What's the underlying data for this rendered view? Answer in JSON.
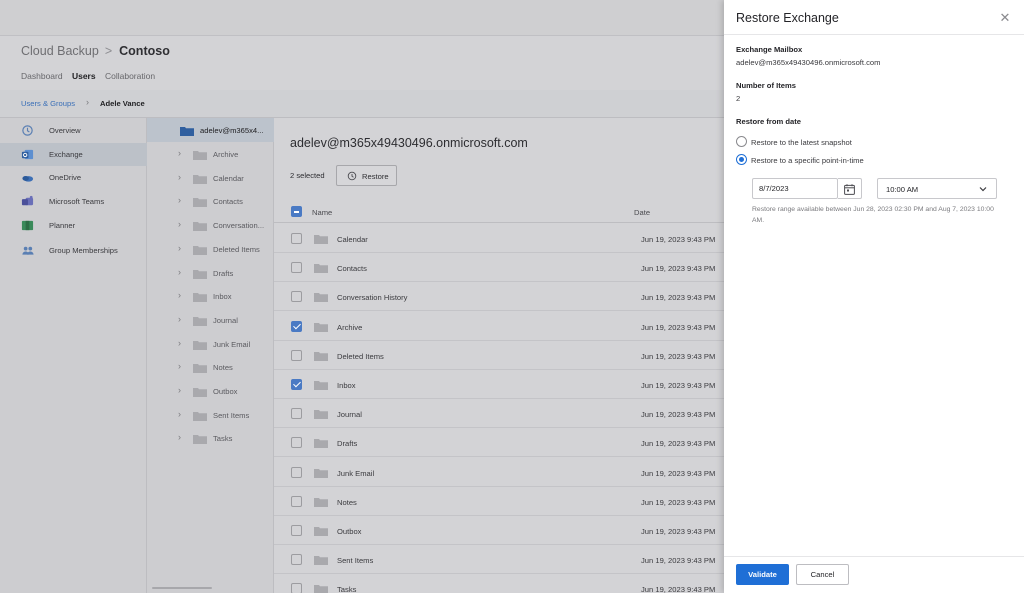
{
  "app": {
    "product": "Cloud Backup",
    "org": "Contoso",
    "tabs": [
      "Dashboard",
      "Users",
      "Collaboration"
    ],
    "active_tab": "Users",
    "breadcrumb": {
      "parent": "Users & Groups",
      "current": "Adele Vance"
    }
  },
  "sidebar": {
    "items": [
      {
        "label": "Overview",
        "icon": "history-icon"
      },
      {
        "label": "Exchange",
        "icon": "outlook-icon",
        "selected": true
      },
      {
        "label": "OneDrive",
        "icon": "onedrive-icon"
      },
      {
        "label": "Microsoft Teams",
        "icon": "teams-icon"
      },
      {
        "label": "Planner",
        "icon": "planner-icon"
      },
      {
        "label": "Group Memberships",
        "icon": "people-icon"
      }
    ]
  },
  "folder_tree": {
    "root": "adelev@m365x4...",
    "folders": [
      "Archive",
      "Calendar",
      "Contacts",
      "Conversation...",
      "Deleted Items",
      "Drafts",
      "Inbox",
      "Journal",
      "Junk Email",
      "Notes",
      "Outbox",
      "Sent Items",
      "Tasks"
    ]
  },
  "main": {
    "title": "adelev@m365x49430496.onmicrosoft.com",
    "selected_count": "2 selected",
    "restore_label": "Restore",
    "columns": {
      "name": "Name",
      "date": "Date"
    },
    "rows": [
      {
        "name": "Calendar",
        "date": "Jun 19, 2023 9:43 PM",
        "checked": false
      },
      {
        "name": "Contacts",
        "date": "Jun 19, 2023 9:43 PM",
        "checked": false
      },
      {
        "name": "Conversation History",
        "date": "Jun 19, 2023 9:43 PM",
        "checked": false
      },
      {
        "name": "Archive",
        "date": "Jun 19, 2023 9:43 PM",
        "checked": true
      },
      {
        "name": "Deleted Items",
        "date": "Jun 19, 2023 9:43 PM",
        "checked": false
      },
      {
        "name": "Inbox",
        "date": "Jun 19, 2023 9:43 PM",
        "checked": true
      },
      {
        "name": "Journal",
        "date": "Jun 19, 2023 9:43 PM",
        "checked": false
      },
      {
        "name": "Drafts",
        "date": "Jun 19, 2023 9:43 PM",
        "checked": false
      },
      {
        "name": "Junk Email",
        "date": "Jun 19, 2023 9:43 PM",
        "checked": false
      },
      {
        "name": "Notes",
        "date": "Jun 19, 2023 9:43 PM",
        "checked": false
      },
      {
        "name": "Outbox",
        "date": "Jun 19, 2023 9:43 PM",
        "checked": false
      },
      {
        "name": "Sent Items",
        "date": "Jun 19, 2023 9:43 PM",
        "checked": false
      },
      {
        "name": "Tasks",
        "date": "Jun 19, 2023 9:43 PM",
        "checked": false
      }
    ]
  },
  "panel": {
    "title": "Restore Exchange",
    "mailbox_label": "Exchange Mailbox",
    "mailbox_value": "adelev@m365x49430496.onmicrosoft.com",
    "items_label": "Number of Items",
    "items_value": "2",
    "restore_from_label": "Restore from date",
    "option_latest": "Restore to the latest snapshot",
    "option_point": "Restore to a specific point-in-time",
    "selected_option": "point",
    "date_value": "8/7/2023",
    "time_value": "10:00 AM",
    "hint": "Restore range available between Jun 28, 2023 02:30 PM and Aug 7, 2023 10:00 AM.",
    "validate_label": "Validate",
    "cancel_label": "Cancel"
  },
  "colors": {
    "accent": "#1f6fd6",
    "checkbox_dimmed": "#4a7ac4",
    "folder": "#a9a9ad",
    "overlay_bg": "#d3d3d6"
  }
}
